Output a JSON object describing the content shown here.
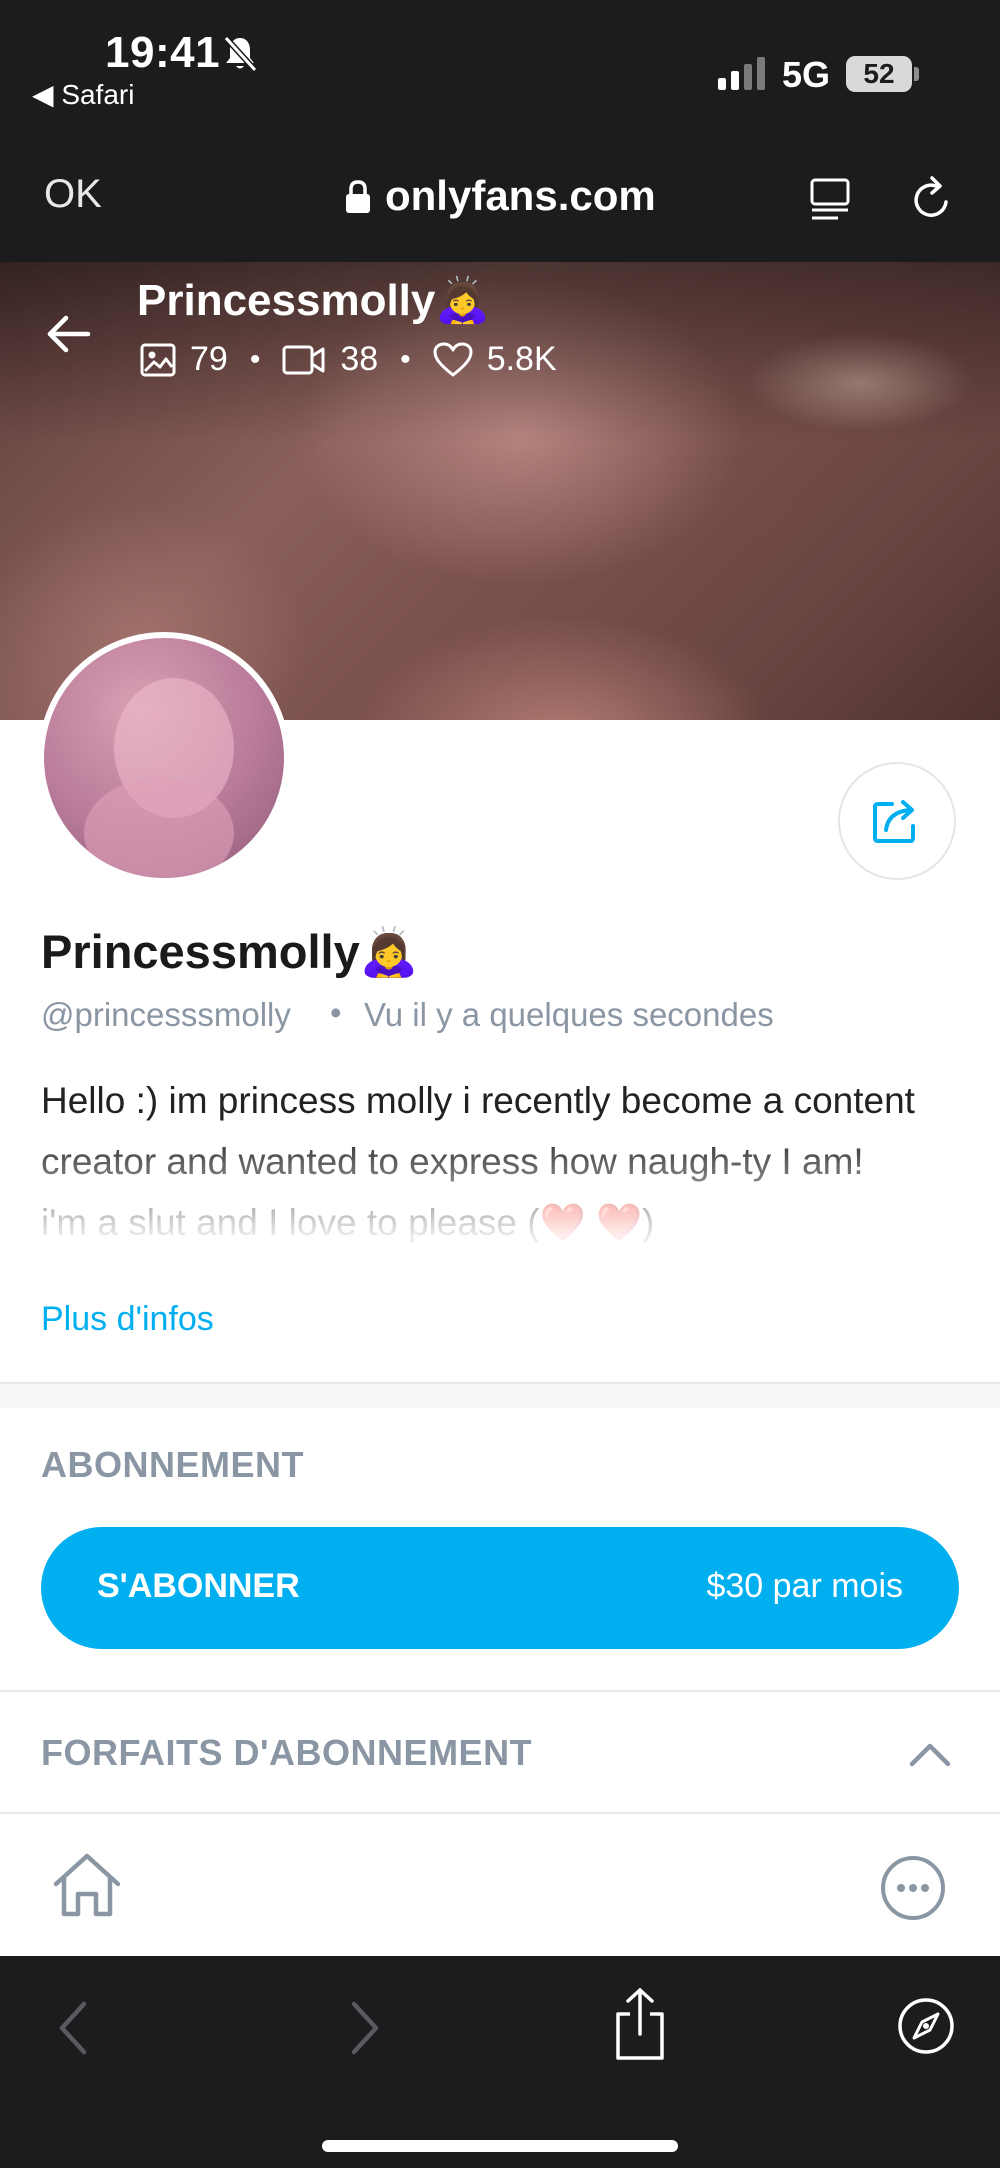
{
  "status_bar": {
    "time": "19:41",
    "back_app": "◀ Safari",
    "network": "5G",
    "battery": "52"
  },
  "browser": {
    "done_label": "OK",
    "url": "onlyfans.com"
  },
  "cover": {
    "name": "Princessmolly🙇‍♀️",
    "photos": "79",
    "videos": "38",
    "likes": "5.8K"
  },
  "profile": {
    "name": "Princessmolly🙇‍♀️",
    "handle": "@princesssmolly",
    "separator": "•",
    "last_seen": "Vu  il y a quelques secondes",
    "bio": "Hello :) im princess molly i recently become a content creator and wanted to express how naugh-ty I am!\ni'm a slut and I love to please (❤️ ❤️)",
    "more_label": "Plus d'infos"
  },
  "subscription": {
    "section_title": "ABONNEMENT",
    "button_label": "S'ABONNER",
    "price": "$30 par mois",
    "plans_title": "FORFAITS D'ABONNEMENT"
  },
  "colors": {
    "accent": "#00aff0",
    "muted_text": "#8a96a3",
    "chrome_bg": "#1c1c1e"
  },
  "icons": [
    "muted-bell-icon",
    "signal-icon",
    "lock-icon",
    "reader-icon",
    "reload-icon",
    "back-arrow-icon",
    "image-icon",
    "video-icon",
    "heart-icon",
    "share-icon",
    "chevron-up-icon",
    "home-icon",
    "more-icon",
    "chevron-left-icon",
    "chevron-right-icon",
    "share-sheet-icon",
    "compass-icon"
  ]
}
